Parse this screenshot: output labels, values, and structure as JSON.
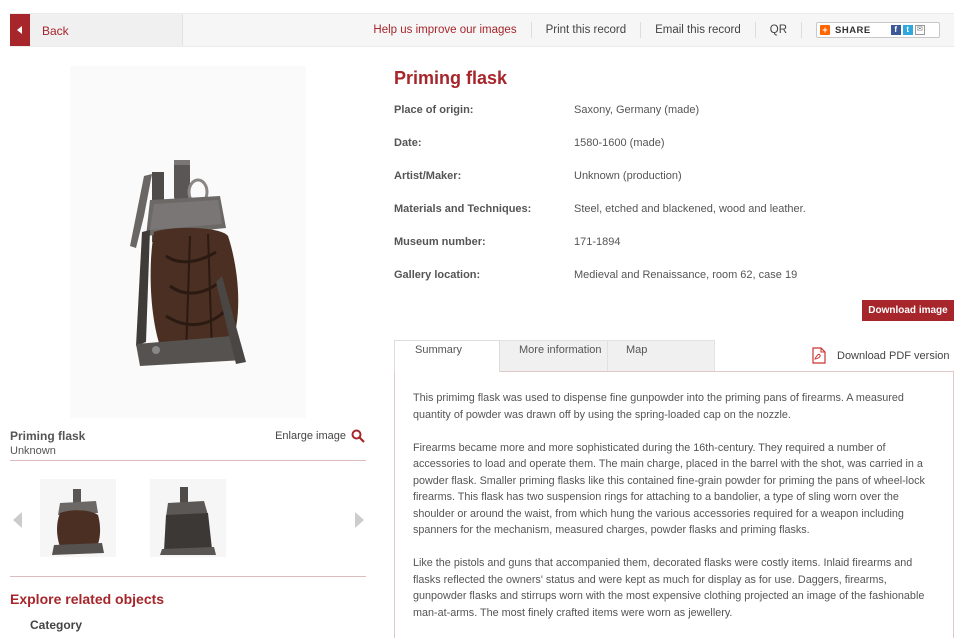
{
  "toolbar": {
    "back_label": "Back",
    "links": [
      "Help us improve our images",
      "Print this record",
      "Email this record",
      "QR"
    ],
    "share_label": "SHARE"
  },
  "image_panel": {
    "object_title": "Priming flask",
    "object_maker": "Unknown",
    "enlarge_label": "Enlarge image",
    "icons": [
      "magnifier-icon",
      "chevron-left-icon",
      "chevron-right-icon"
    ]
  },
  "related": {
    "title": "Explore related objects",
    "category_label": "Category"
  },
  "record": {
    "title": "Priming flask",
    "fields": [
      {
        "label": "Place of origin:",
        "value": "Saxony, Germany (made)"
      },
      {
        "label": "Date:",
        "value": "1580-1600 (made)"
      },
      {
        "label": "Artist/Maker:",
        "value": "Unknown (production)"
      },
      {
        "label": "Materials and Techniques:",
        "value": "Steel, etched and blackened, wood and leather."
      },
      {
        "label": "Museum number:",
        "value": "171-1894"
      },
      {
        "label": "Gallery location:",
        "value": "Medieval and Renaissance, room 62, case 19"
      }
    ],
    "download_label": "Download image"
  },
  "tabs": {
    "items": [
      "Summary",
      "More information",
      "Map"
    ],
    "active": "Summary",
    "pdf_label": "Download PDF version"
  },
  "summary": {
    "paragraphs": [
      "This primimg flask was used to dispense fine gunpowder into the priming pans of firearms. A measured quantity of powder was drawn off by using the spring-loaded cap on the nozzle.",
      "Firearms became more and more sophisticated during the 16th-century. They required a number of accessories to load and operate them. The main charge, placed in the barrel with the shot, was carried in a powder flask. Smaller priming flasks like this contained fine-grain powder for priming the pans of wheel-lock firearms. This flask has two suspension rings for attaching to a bandolier, a type of sling worn over the shoulder or around the waist, from which hung the various accessories required for a weapon including spanners for the mechanism, measured charges, powder flasks and priming flasks.",
      "Like the pistols and guns that accompanied them, decorated flasks were costly items. Inlaid firearms and flasks reflected the owners' status and were kept as much for display as for use. Daggers, firearms, gunpowder flasks and stirrups worn with the most expensive clothing projected an image of the fashionable man-at-arms. The most finely crafted items were worn as jewellery."
    ]
  },
  "colors": {
    "accent": "#a6262b",
    "text": "#555555"
  }
}
